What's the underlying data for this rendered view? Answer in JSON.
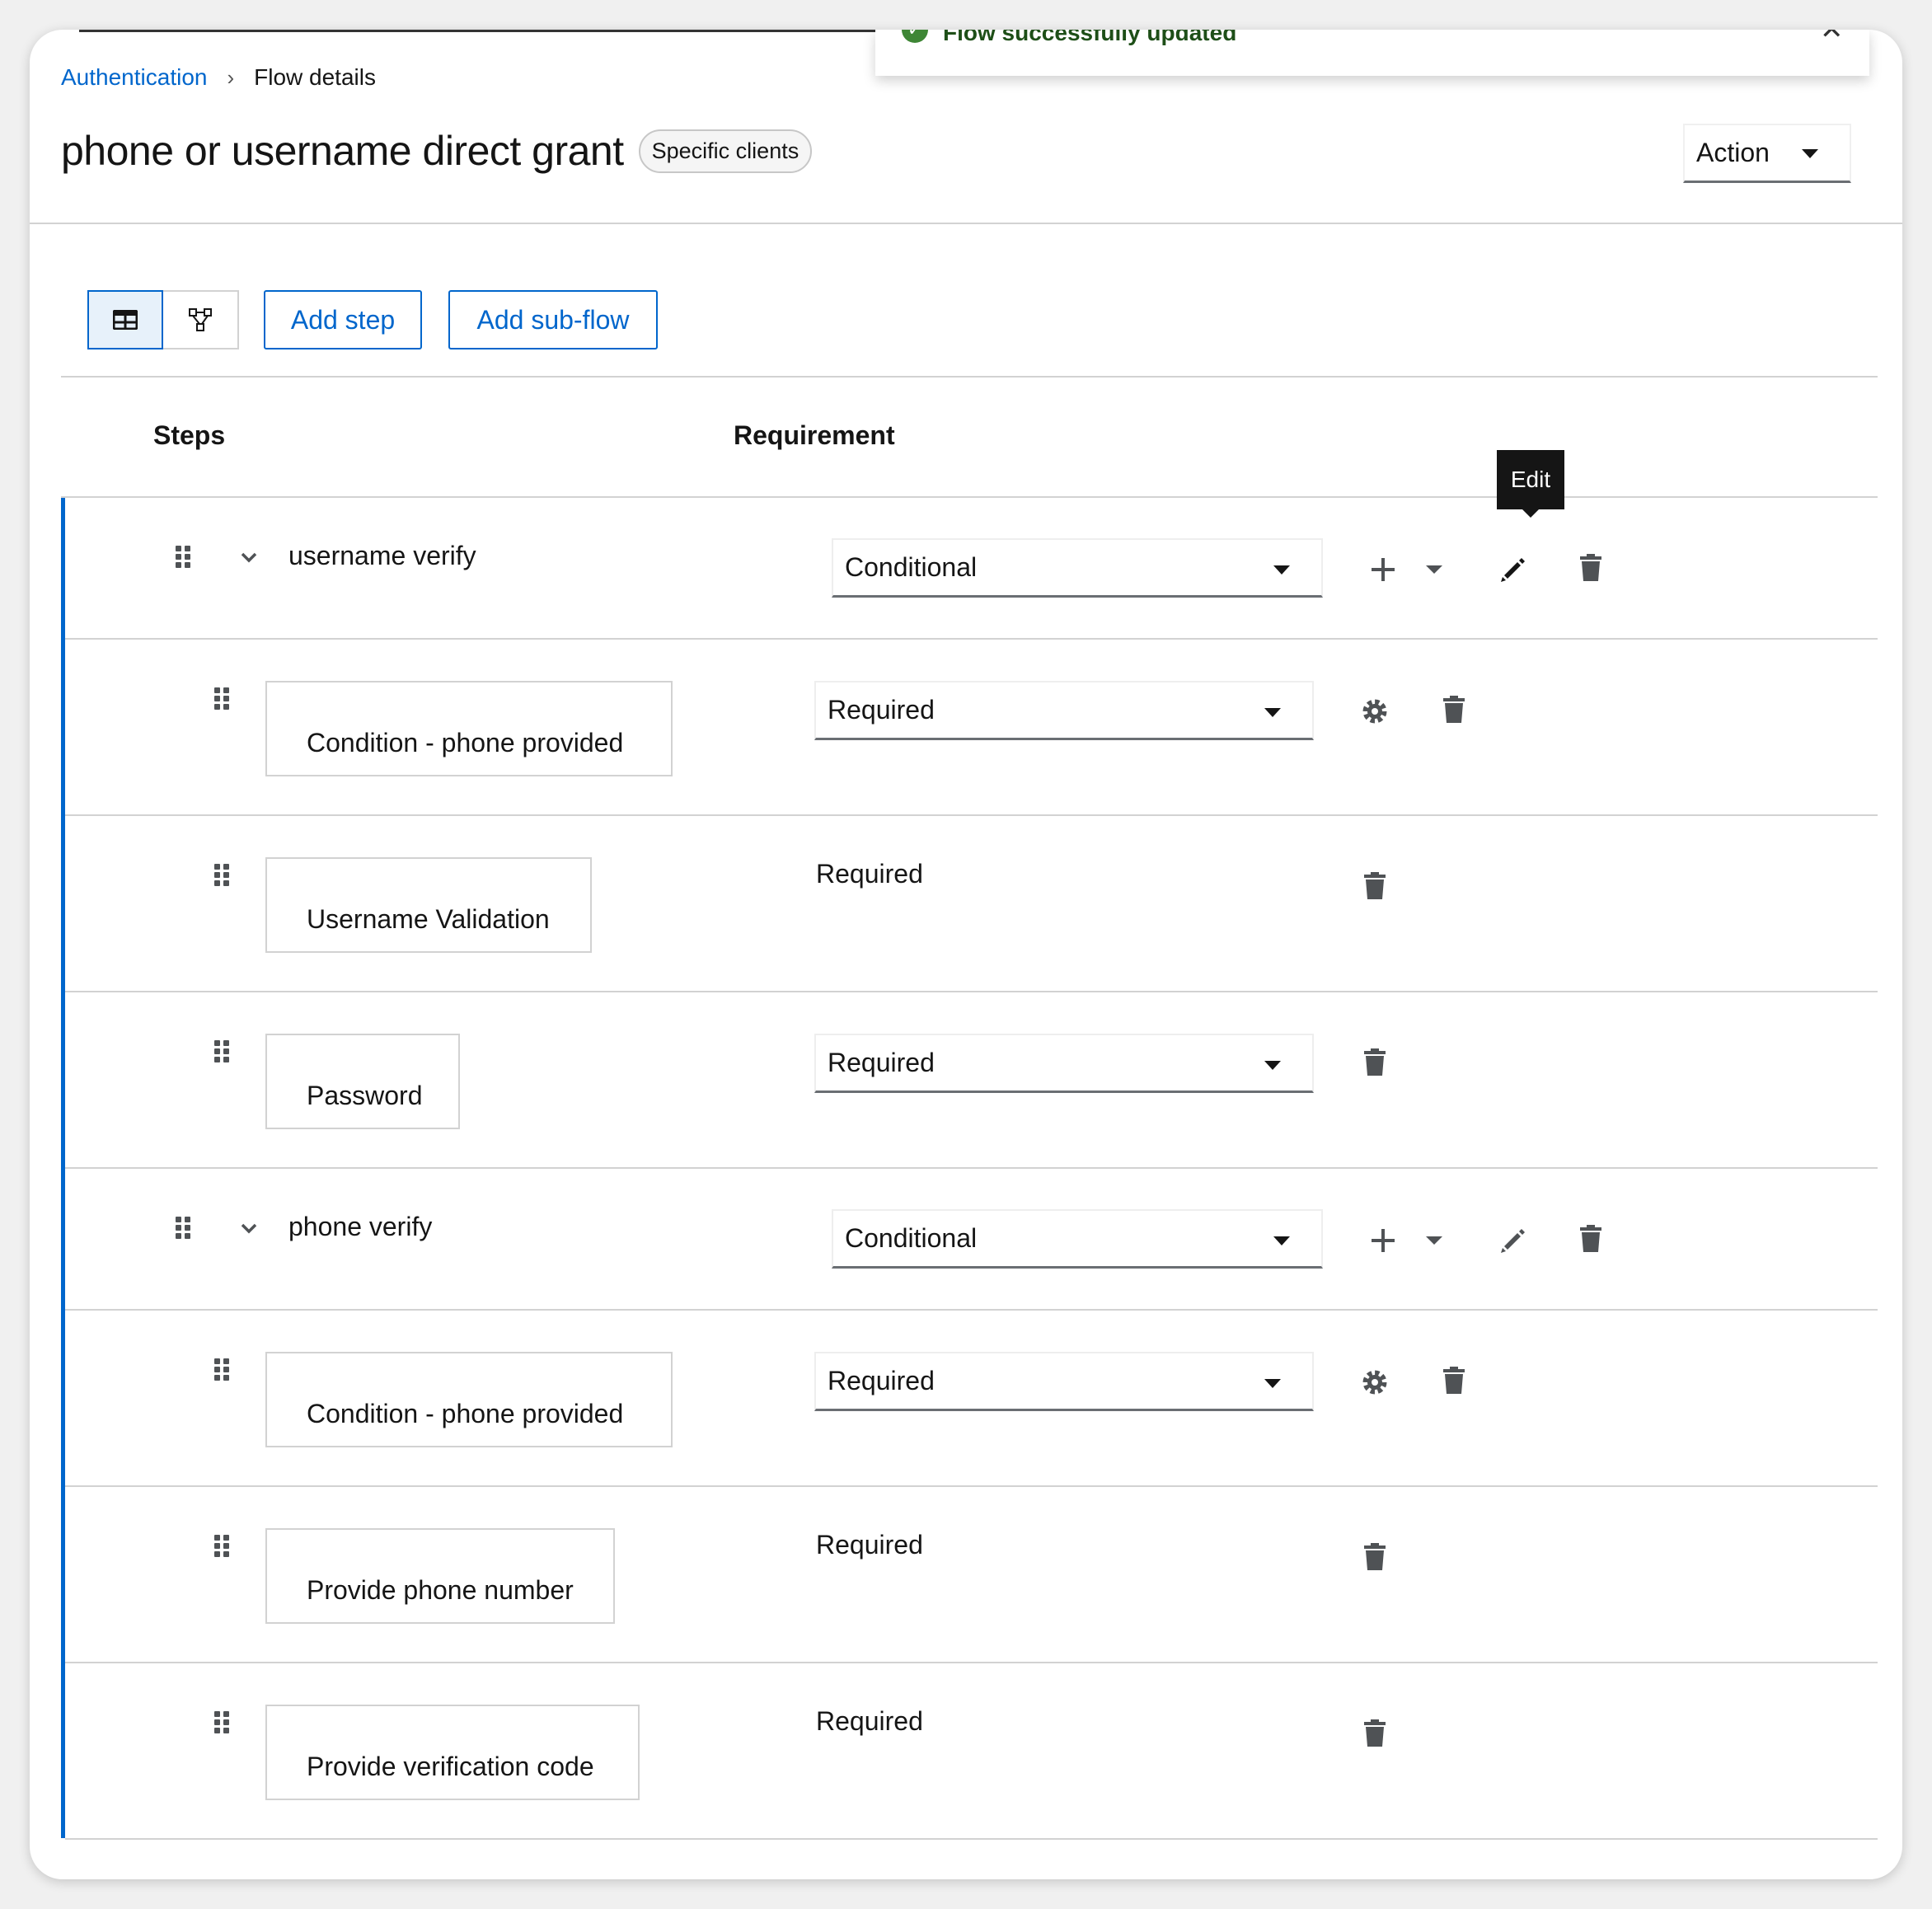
{
  "breadcrumb": {
    "parent": "Authentication",
    "current": "Flow details"
  },
  "page": {
    "title": "phone or username direct grant",
    "badge": "Specific clients"
  },
  "action": {
    "label": "Action"
  },
  "toast": {
    "message": "Flow successfully updated"
  },
  "toolbar": {
    "add_step": "Add step",
    "add_subflow": "Add sub-flow"
  },
  "table": {
    "col_steps": "Steps",
    "col_requirement": "Requirement"
  },
  "tooltip": {
    "text": "Edit"
  },
  "colors": {
    "link": "#0066cc",
    "success": "#3e8635",
    "border": "#d2d2d2"
  },
  "rows": [
    {
      "name": "username verify",
      "requirement": "Conditional"
    },
    {
      "name": "Condition - phone provided",
      "requirement": "Required"
    },
    {
      "name": "Username Validation",
      "requirement": "Required"
    },
    {
      "name": "Password",
      "requirement": "Required"
    },
    {
      "name": "phone verify",
      "requirement": "Conditional"
    },
    {
      "name": "Condition - phone provided",
      "requirement": "Required"
    },
    {
      "name": "Provide phone number",
      "requirement": "Required"
    },
    {
      "name": "Provide verification code",
      "requirement": "Required"
    }
  ]
}
